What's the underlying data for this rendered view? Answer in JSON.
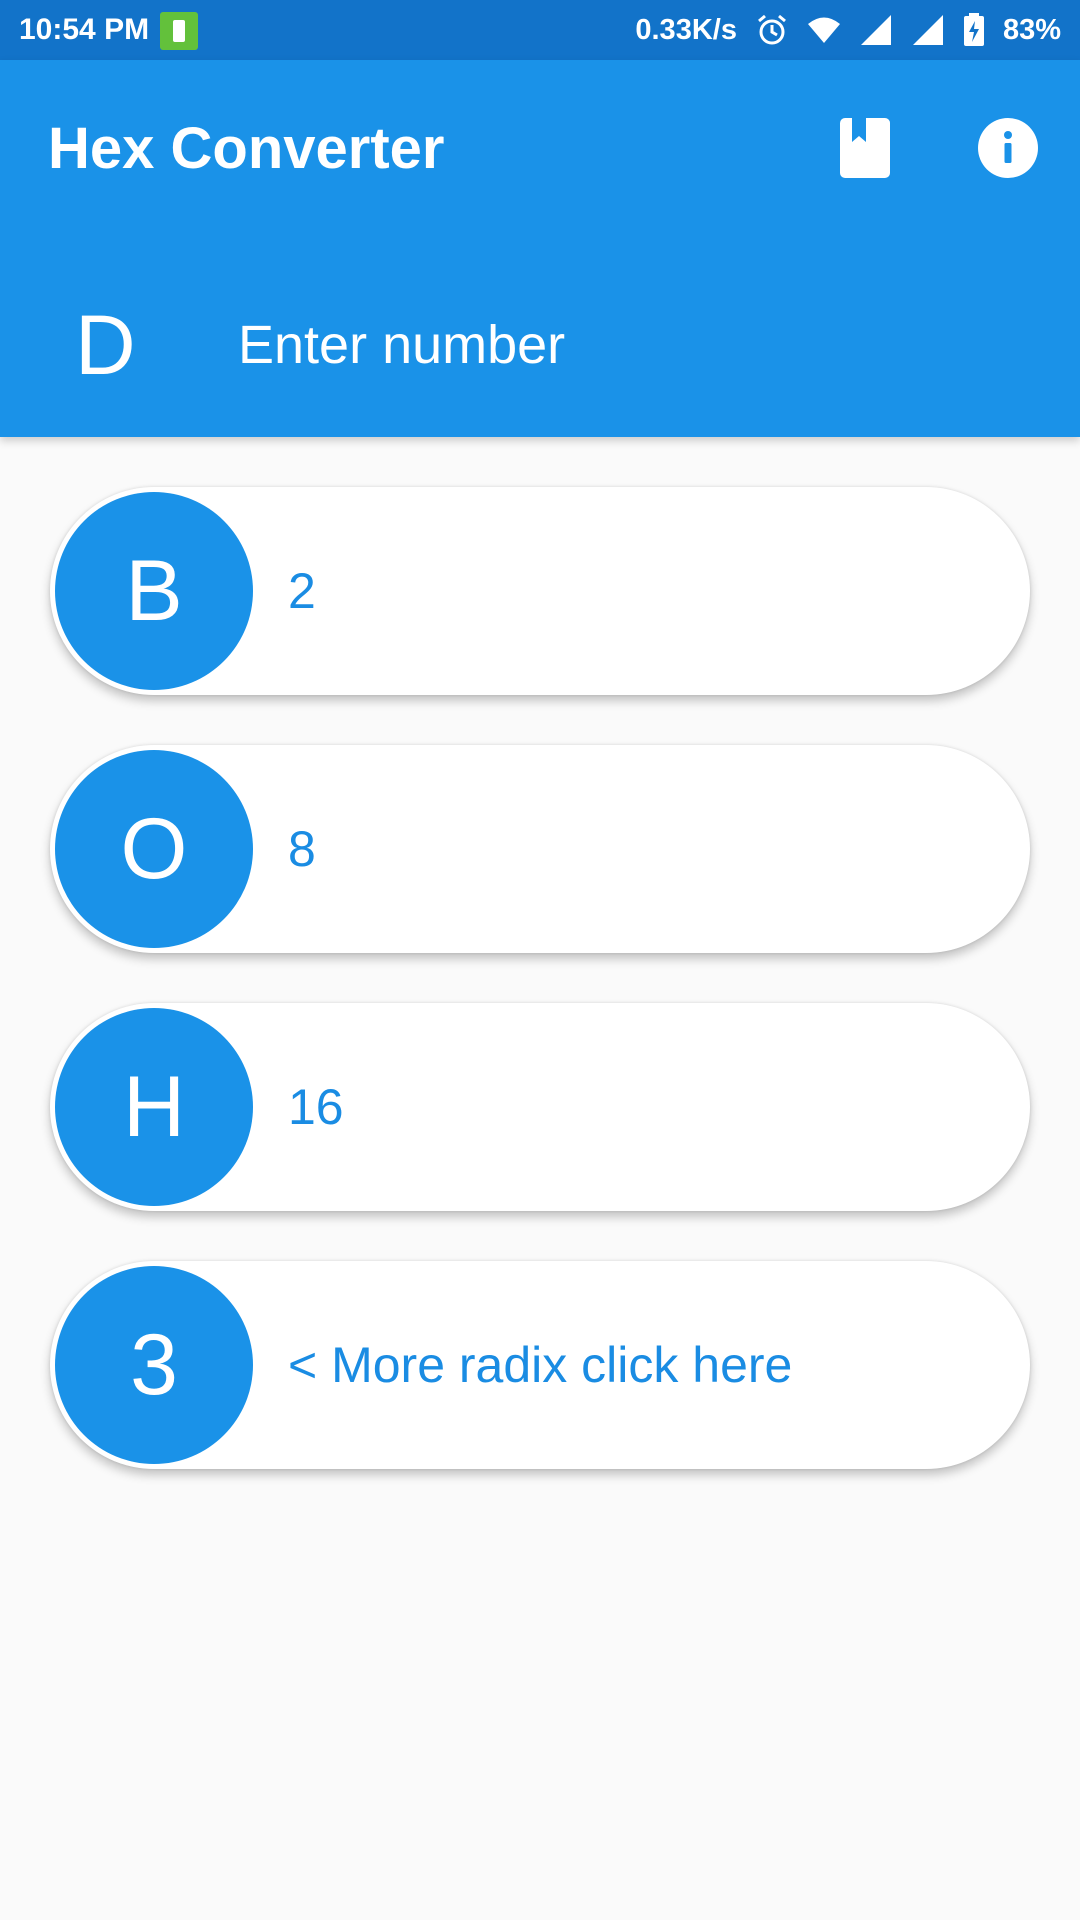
{
  "status_bar": {
    "time": "10:54 PM",
    "net_speed": "0.33K/s",
    "battery": "83%",
    "icons": [
      "battery-saver-icon",
      "alarm-icon",
      "wifi-icon",
      "signal-icon",
      "signal-icon",
      "battery-charging-icon"
    ]
  },
  "app_bar": {
    "title": "Hex Converter",
    "bookmark_icon": "book-icon",
    "info_icon": "info-icon"
  },
  "input": {
    "radix_letter": "D",
    "value": "",
    "placeholder": "Enter number"
  },
  "cards": [
    {
      "letter": "B",
      "value": "2"
    },
    {
      "letter": "O",
      "value": "8"
    },
    {
      "letter": "H",
      "value": "16"
    },
    {
      "letter": "3",
      "value": "< More radix click here"
    }
  ],
  "colors": {
    "primary": "#1a92e8",
    "status_bar": "#1273c9",
    "background": "#fafafa",
    "card": "#ffffff"
  }
}
